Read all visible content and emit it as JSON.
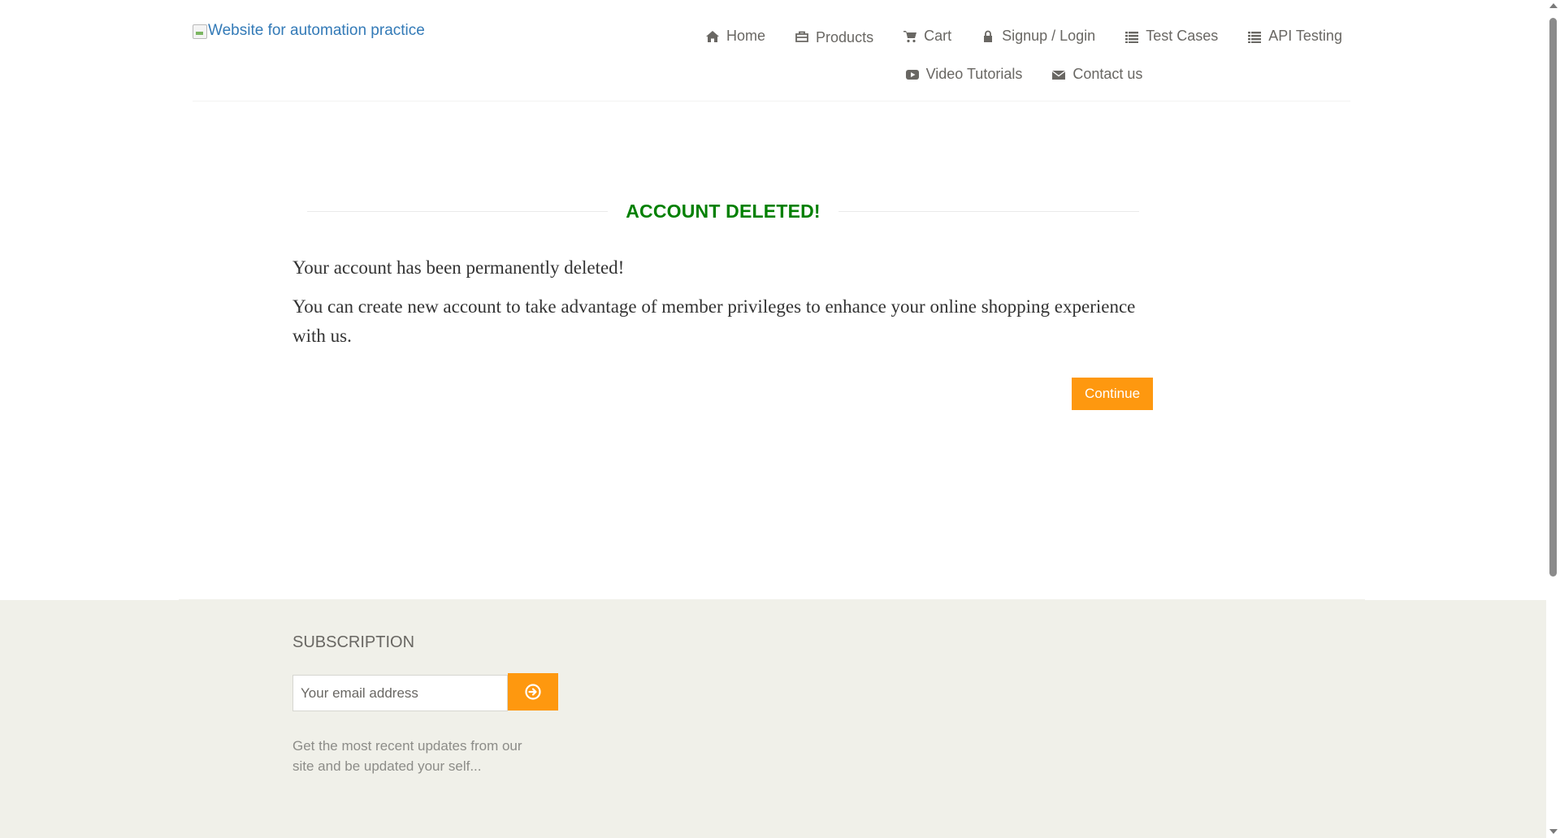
{
  "header": {
    "logo_alt": "Website for automation practice",
    "nav": [
      {
        "label": "Home",
        "icon": "home-icon"
      },
      {
        "label": "Products",
        "icon": "briefcase-icon"
      },
      {
        "label": "Cart",
        "icon": "shopping-cart-icon"
      },
      {
        "label": "Signup / Login",
        "icon": "lock-icon"
      },
      {
        "label": "Test Cases",
        "icon": "list-icon"
      },
      {
        "label": "API Testing",
        "icon": "list-icon"
      },
      {
        "label": "Video Tutorials",
        "icon": "youtube-play-icon"
      },
      {
        "label": "Contact us",
        "icon": "envelope-icon"
      }
    ]
  },
  "main": {
    "title": "ACCOUNT DELETED!",
    "message_1": "Your account has been permanently deleted!",
    "message_2": "You can create new account to take advantage of member privileges to enhance your online shopping experience with us.",
    "continue_label": "Continue"
  },
  "footer": {
    "subscription_title": "SUBSCRIPTION",
    "email_placeholder": "Your email address",
    "subscribe_icon": "arrow-circle-right-icon",
    "description": "Get the most recent updates from our site and be updated your self..."
  },
  "colors": {
    "title_green": "#008000",
    "accent_orange": "#FE980F",
    "footer_bg": "#F0F0E9",
    "nav_text": "#696763",
    "link_blue": "#337AB7"
  }
}
